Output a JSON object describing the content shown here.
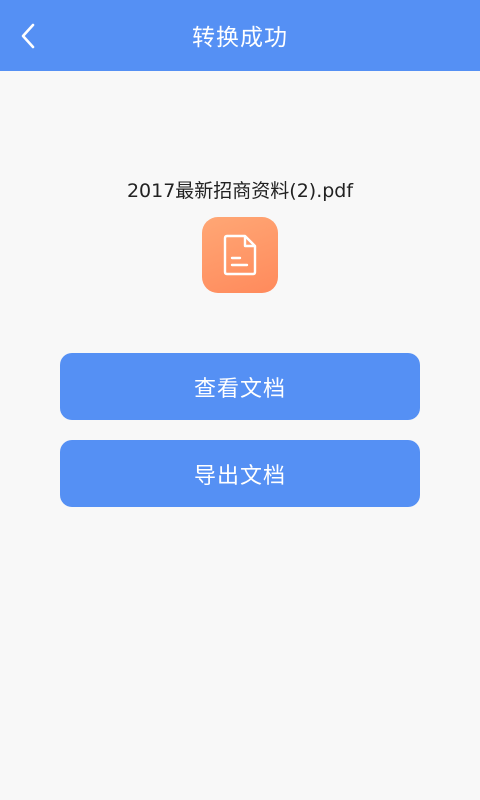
{
  "header": {
    "title": "转换成功",
    "back_icon": "chevron-left-icon"
  },
  "file": {
    "name": "2017最新招商资料(2).pdf",
    "icon": "document-icon"
  },
  "actions": {
    "view_label": "查看文档",
    "export_label": "导出文档"
  },
  "colors": {
    "primary": "#5590f4",
    "background": "#f8f8f8",
    "file_icon_gradient_start": "#ffa775",
    "file_icon_gradient_end": "#ff8a5c"
  }
}
